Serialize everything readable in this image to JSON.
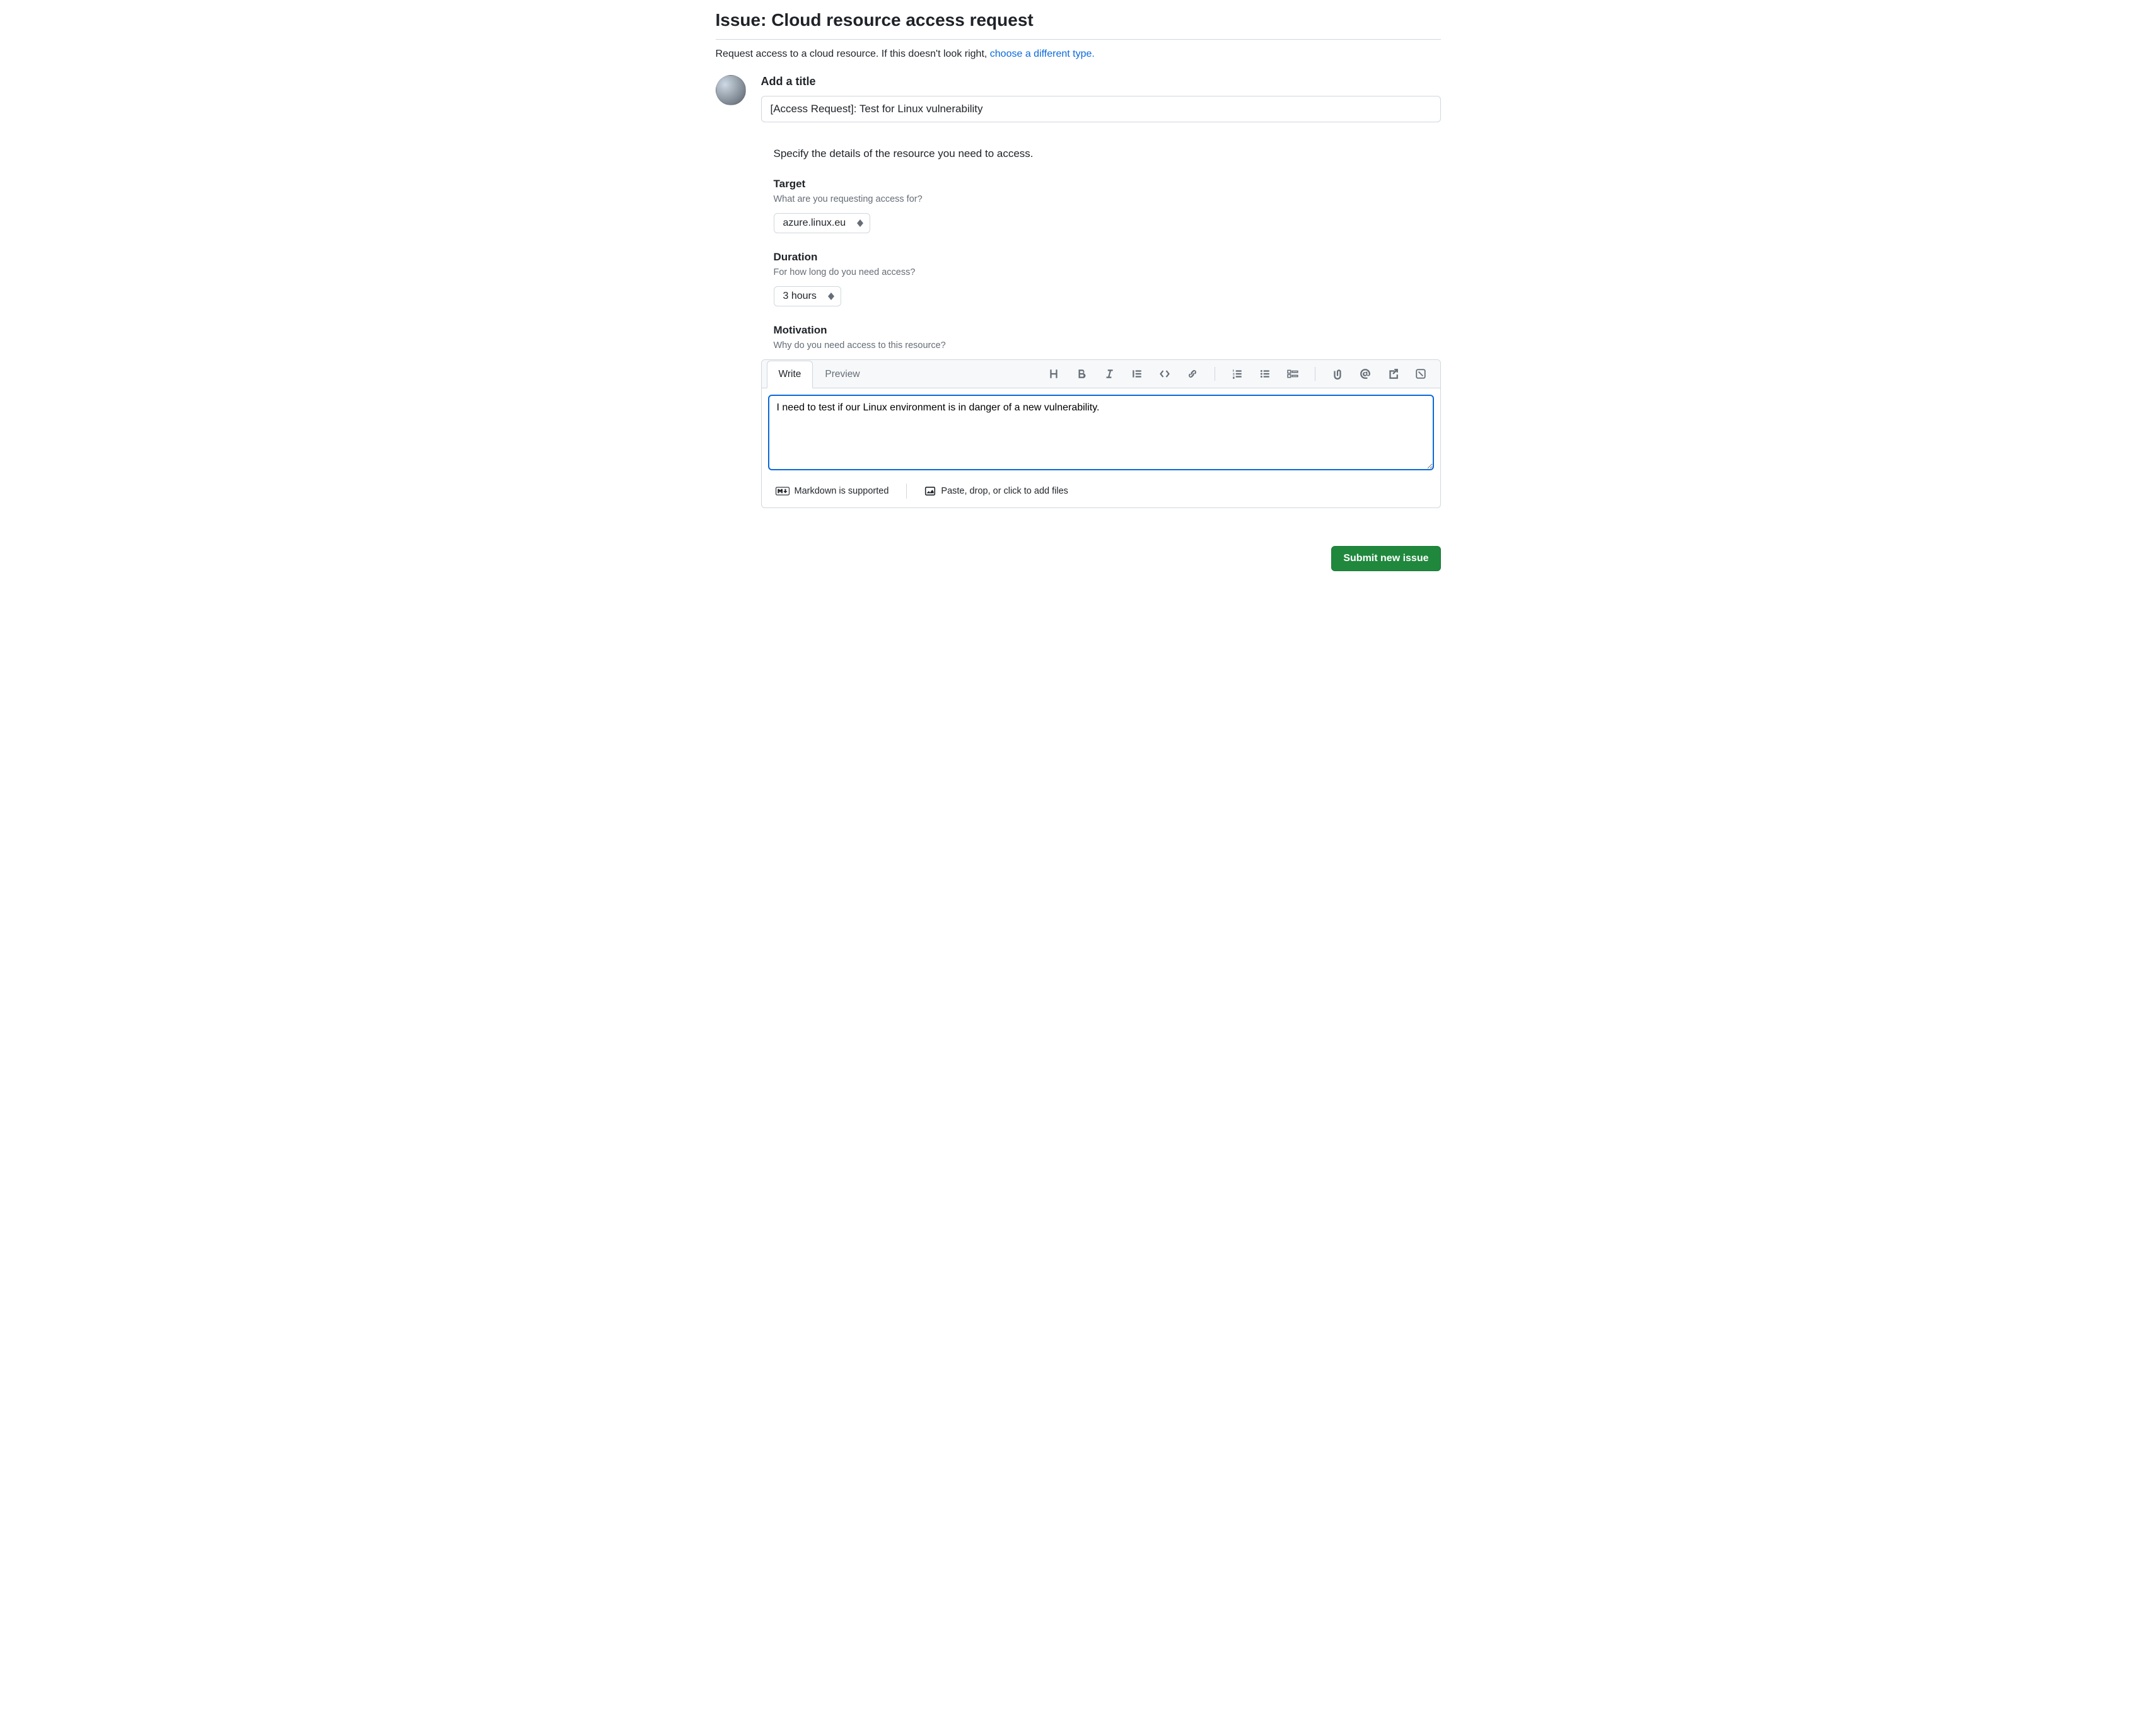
{
  "page": {
    "title": "Issue: Cloud resource access request",
    "intro_text": "Request access to a cloud resource. If this doesn't look right, ",
    "intro_link": "choose a different type."
  },
  "title_section": {
    "label": "Add a title",
    "value": "[Access Request]: Test for Linux vulnerability"
  },
  "details_intro": "Specify the details of the resource you need to access.",
  "target": {
    "label": "Target",
    "help": "What are you requesting access for?",
    "selected": "azure.linux.eu"
  },
  "duration": {
    "label": "Duration",
    "help": "For how long do you need access?",
    "selected": "3 hours"
  },
  "motivation": {
    "label": "Motivation",
    "help": "Why do you need access to this resource?"
  },
  "editor": {
    "tabs": {
      "write": "Write",
      "preview": "Preview"
    },
    "text": "I need to test if our Linux environment is in danger of a new vulnerability.",
    "footer_markdown": "Markdown is supported",
    "footer_files": "Paste, drop, or click to add files"
  },
  "submit_label": "Submit new issue"
}
